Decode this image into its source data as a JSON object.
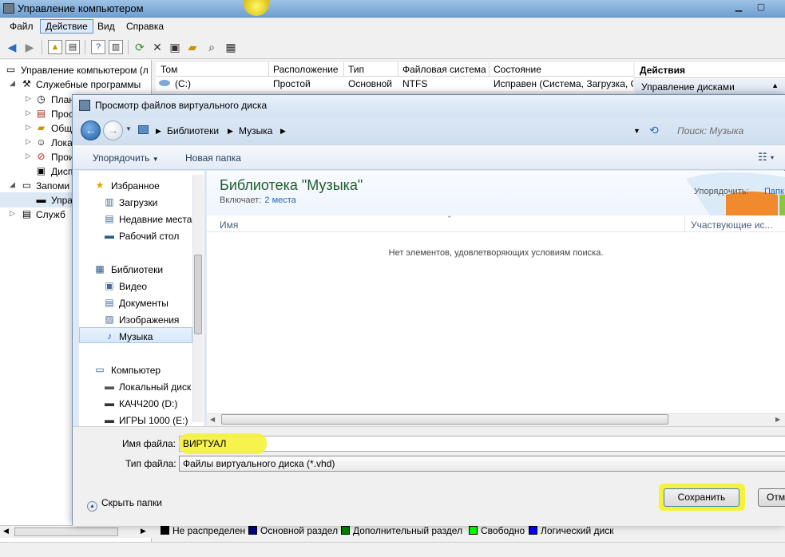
{
  "window": {
    "title": "Управление компьютером"
  },
  "menu": [
    "Файл",
    "Действие",
    "Вид",
    "Справка"
  ],
  "tree": [
    {
      "label": "Управление компьютером (л",
      "level": 0,
      "icon": "computer-management-icon"
    },
    {
      "label": "Служебные программы",
      "level": 1,
      "icon": "tools-icon"
    },
    {
      "label": "Плани",
      "level": 2,
      "icon": "clock-icon"
    },
    {
      "label": "Просм",
      "level": 2,
      "icon": "event-viewer-icon"
    },
    {
      "label": "Общи",
      "level": 2,
      "icon": "shared-folder-icon"
    },
    {
      "label": "Лока",
      "level": 2,
      "icon": "users-icon"
    },
    {
      "label": "Прои",
      "level": 2,
      "icon": "performance-icon"
    },
    {
      "label": "Дисп",
      "level": 2,
      "icon": "device-manager-icon"
    },
    {
      "label": "Запоми",
      "level": 1,
      "icon": "storage-icon"
    },
    {
      "label": "Упра",
      "level": 2,
      "icon": "disk-management-icon"
    },
    {
      "label": "Служб",
      "level": 1,
      "icon": "services-icon"
    }
  ],
  "volumes": {
    "headers": [
      "Том",
      "Расположение",
      "Тип",
      "Файловая система",
      "Состояние"
    ],
    "rows": [
      [
        "(C:)",
        "Простой",
        "Основной",
        "NTFS",
        "Исправен (Система, Загрузка, С"
      ]
    ]
  },
  "actions": {
    "title": "Действия",
    "item": "Управление дисками"
  },
  "legend": [
    {
      "label": "Не распределен",
      "color": "#000000"
    },
    {
      "label": "Основной раздел",
      "color": "#000080"
    },
    {
      "label": "Дополнительный раздел",
      "color": "#008000"
    },
    {
      "label": "Свободно",
      "color": "#00ff00"
    },
    {
      "label": "Логический диск",
      "color": "#0000ff"
    }
  ],
  "dialog": {
    "title": "Просмотр файлов виртуального диска",
    "breadcrumb": [
      "Библиотеки",
      "Музыка"
    ],
    "search_placeholder": "Поиск: Музыка",
    "commands": {
      "organize": "Упорядочить",
      "new_folder": "Новая папка"
    },
    "nav": [
      {
        "label": "Избранное",
        "type": "group",
        "icon": "star-icon"
      },
      {
        "label": "Загрузки",
        "type": "item",
        "icon": "downloads-icon"
      },
      {
        "label": "Недавние места",
        "type": "item",
        "icon": "recent-places-icon"
      },
      {
        "label": "Рабочий стол",
        "type": "item",
        "icon": "desktop-icon"
      },
      {
        "label": "Библиотеки",
        "type": "group",
        "icon": "libraries-icon"
      },
      {
        "label": "Видео",
        "type": "item",
        "icon": "video-icon"
      },
      {
        "label": "Документы",
        "type": "item",
        "icon": "documents-icon"
      },
      {
        "label": "Изображения",
        "type": "item",
        "icon": "pictures-icon"
      },
      {
        "label": "Музыка",
        "type": "item",
        "icon": "music-icon",
        "selected": true
      },
      {
        "label": "Компьютер",
        "type": "group",
        "icon": "computer-icon"
      },
      {
        "label": "Локальный диск",
        "type": "item",
        "icon": "local-disk-icon"
      },
      {
        "label": "КАЧЧ200 (D:)",
        "type": "item",
        "icon": "drive-icon"
      },
      {
        "label": "ИГРЫ 1000 (E:)",
        "type": "item",
        "icon": "drive-icon"
      }
    ],
    "library": {
      "title": "Библиотека \"Музыка\"",
      "includes_label": "Включает:",
      "includes_value": "2 места",
      "sort_label": "Упорядочить:",
      "sort_value": "Папк"
    },
    "columns": [
      "Имя",
      "Участвующие ис..."
    ],
    "empty_message": "Нет элементов, удовлетворяющих условиям поиска.",
    "filename_label": "Имя файла:",
    "filename_value": "ВИРТУАЛ",
    "filetype_label": "Тип файла:",
    "filetype_value": "Файлы виртуального диска (*.vhd)",
    "hide_folders": "Скрыть папки",
    "save": "Сохранить",
    "cancel": "Отм",
    "highlight_color": "#f5f23a"
  }
}
